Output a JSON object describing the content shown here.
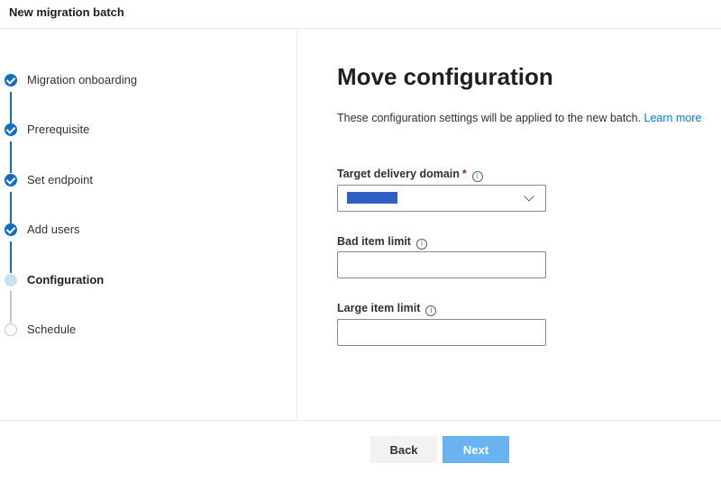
{
  "header": {
    "title": "New migration batch"
  },
  "steps": [
    {
      "label": "Migration onboarding",
      "state": "done"
    },
    {
      "label": "Prerequisite",
      "state": "done"
    },
    {
      "label": "Set endpoint",
      "state": "done"
    },
    {
      "label": "Add users",
      "state": "done"
    },
    {
      "label": "Configuration",
      "state": "current"
    },
    {
      "label": "Schedule",
      "state": "pending"
    }
  ],
  "main": {
    "title": "Move configuration",
    "description": "These configuration settings will be applied to the new batch.",
    "learn_more": "Learn more",
    "fields": {
      "target_domain": {
        "label": "Target delivery domain",
        "required_mark": "*",
        "value": ""
      },
      "bad_item_limit": {
        "label": "Bad item limit",
        "value": ""
      },
      "large_item_limit": {
        "label": "Large item limit",
        "value": ""
      }
    }
  },
  "footer": {
    "back_label": "Back",
    "next_label": "Next"
  },
  "colors": {
    "accent": "#106ebe",
    "step_current": "#c7e0f4",
    "next_button": "#69b4f0",
    "back_button": "#f3f2f1",
    "redaction": "#2f5fc4"
  },
  "icons": {
    "step_done": "check-circle-icon",
    "info": "info-icon",
    "dropdown": "chevron-down-icon"
  }
}
